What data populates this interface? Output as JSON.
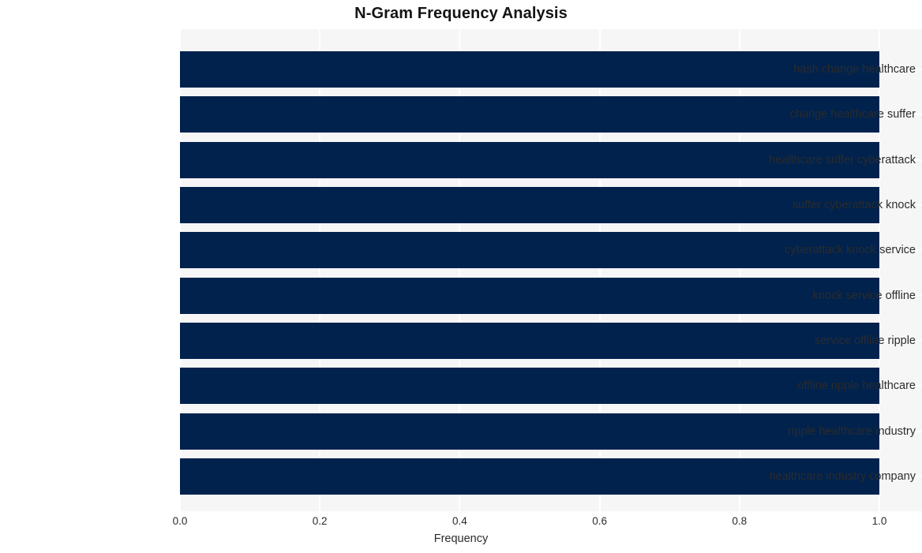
{
  "chart_data": {
    "type": "bar",
    "orientation": "horizontal",
    "title": "N-Gram Frequency Analysis",
    "xlabel": "Frequency",
    "ylabel": "",
    "xlim": [
      0.0,
      1.0
    ],
    "xticks": [
      "0.0",
      "0.2",
      "0.4",
      "0.6",
      "0.8",
      "1.0"
    ],
    "xtick_values": [
      0.0,
      0.2,
      0.4,
      0.6,
      0.8,
      1.0
    ],
    "grid": true,
    "legend": null,
    "bar_color": "#00224d",
    "plot_background": "#f6f6f6",
    "gridline_color": "#ffffff",
    "categories": [
      "hash change healthcare",
      "change healthcare suffer",
      "healthcare suffer cyberattack",
      "suffer cyberattack knock",
      "cyberattack knock service",
      "knock service offline",
      "service offline ripple",
      "offline ripple healthcare",
      "ripple healthcare industry",
      "healthcare industry company"
    ],
    "values": [
      1.0,
      1.0,
      1.0,
      1.0,
      1.0,
      1.0,
      1.0,
      1.0,
      1.0,
      1.0
    ]
  }
}
